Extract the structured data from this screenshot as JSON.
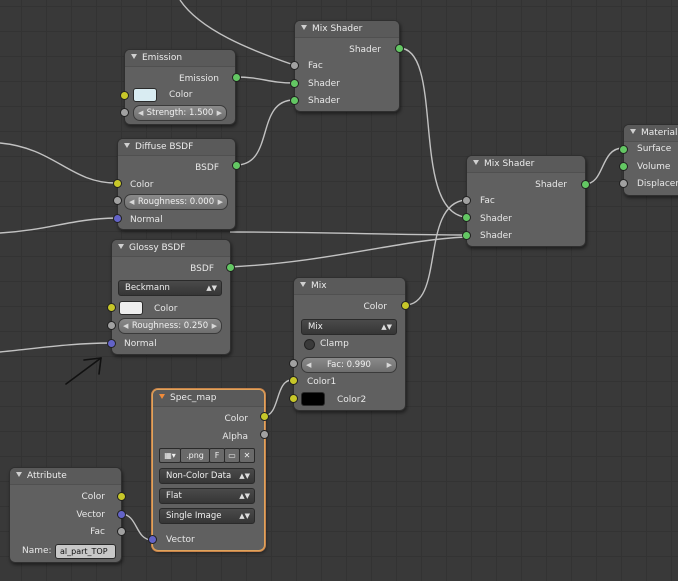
{
  "nodes": {
    "mix_shader_1": {
      "title": "Mix Shader",
      "out_shader": "Shader",
      "in_fac": "Fac",
      "in_shader_1": "Shader",
      "in_shader_2": "Shader"
    },
    "emission": {
      "title": "Emission",
      "out_emission": "Emission",
      "color_label": "Color",
      "color_value": "#d9ecf2",
      "strength_field": "Strength: 1.500"
    },
    "diffuse": {
      "title": "Diffuse BSDF",
      "out_bsdf": "BSDF",
      "color_label": "Color",
      "roughness_field": "Roughness: 0.000",
      "normal_label": "Normal"
    },
    "mix_shader_2": {
      "title": "Mix Shader",
      "out_shader": "Shader",
      "in_fac": "Fac",
      "in_shader_1": "Shader",
      "in_shader_2": "Shader"
    },
    "material_output": {
      "title": "Material O",
      "surface": "Surface",
      "volume": "Volume",
      "displacement": "Displaceme"
    },
    "glossy": {
      "title": "Glossy BSDF",
      "out_bsdf": "BSDF",
      "distribution": "Beckmann",
      "color_label": "Color",
      "color_value": "#eeeeee",
      "roughness_field": "Roughness: 0.250",
      "normal_label": "Normal"
    },
    "mix": {
      "title": "Mix",
      "out_color": "Color",
      "blend": "Mix",
      "clamp_label": "Clamp",
      "fac_field": "Fac: 0.990",
      "color1_label": "Color1",
      "color2_label": "Color2",
      "color2_value": "#000000"
    },
    "spec_map": {
      "title": "Spec_map",
      "out_color": "Color",
      "out_alpha": "Alpha",
      "image_name": ".png",
      "fake_user": "F",
      "color_space": "Non-Color Data",
      "projection": "Flat",
      "source": "Single Image",
      "vector_label": "Vector"
    },
    "attribute": {
      "title": "Attribute",
      "out_color": "Color",
      "out_vector": "Vector",
      "out_fac": "Fac",
      "name_label": "Name:",
      "name_value": "al_part_TOP"
    }
  },
  "colors": {
    "background": "#393939",
    "node_body": "#606060",
    "link": "#c0c0c0",
    "socket_shader": "#63c763",
    "socket_color": "#c7c729",
    "socket_float": "#a1a1a1",
    "socket_vector": "#6363c7",
    "selected_border": "#e0a45c"
  },
  "icons": [
    "collapse-triangle-icon",
    "image-browse-icon",
    "folder-open-icon",
    "unlink-x-icon",
    "dropdown-chevron-icon",
    "field-arrow-icon",
    "annotation-arrow"
  ]
}
